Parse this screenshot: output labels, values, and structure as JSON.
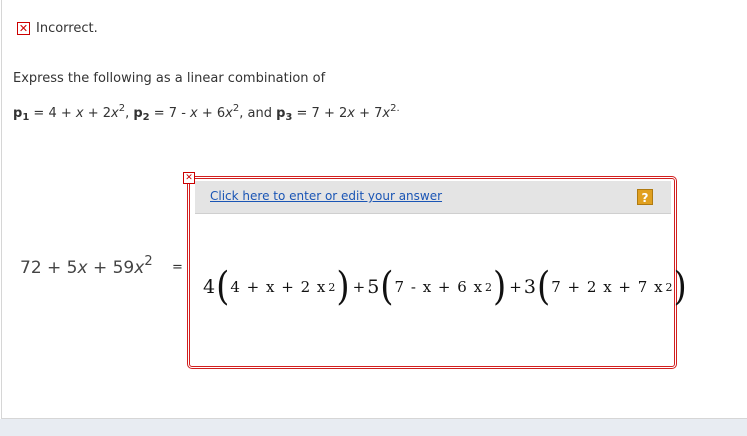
{
  "status": {
    "icon": "x-mark-icon",
    "text": "Incorrect."
  },
  "question": {
    "prompt": "Express the following as a linear combination of",
    "p1_label": "p",
    "p1_sub": "1",
    "p1_expr_a": " = 4 + ",
    "p1_x": "x",
    "p1_expr_b": " + 2",
    "p1_x2": "x",
    "p1_pow": "2",
    "p1_sep": ", ",
    "p2_label": "p",
    "p2_sub": "2",
    "p2_expr_a": " = 7 - ",
    "p2_x": "x",
    "p2_expr_b": " + 6",
    "p2_x2": "x",
    "p2_pow": "2",
    "p2_sep": ", and ",
    "p3_label": "p",
    "p3_sub": "3",
    "p3_expr_a": " = 7 + 2",
    "p3_x": "x",
    "p3_expr_b": " + 7",
    "p3_x2": "x",
    "p3_pow": "2.",
    "lhs_a": "72 + 5",
    "lhs_x": "x",
    "lhs_b": " + 59",
    "lhs_x2": "x",
    "lhs_pow": "2",
    "equals": "="
  },
  "answer": {
    "edit_link": "Click here to enter or edit your answer",
    "help_icon": "?",
    "frame_icon": "x-mark-icon",
    "c1": "4",
    "c2": "5",
    "c3": "3",
    "t1": "4 + x + 2 x",
    "t2": "7 -  x + 6 x",
    "t3": "7 + 2 x + 7 x",
    "pow": "2",
    "plus": "+"
  },
  "colors": {
    "error": "#cc0000",
    "link": "#1a55b5",
    "help": "#e0a020",
    "header_bg": "#e4e4e4"
  }
}
